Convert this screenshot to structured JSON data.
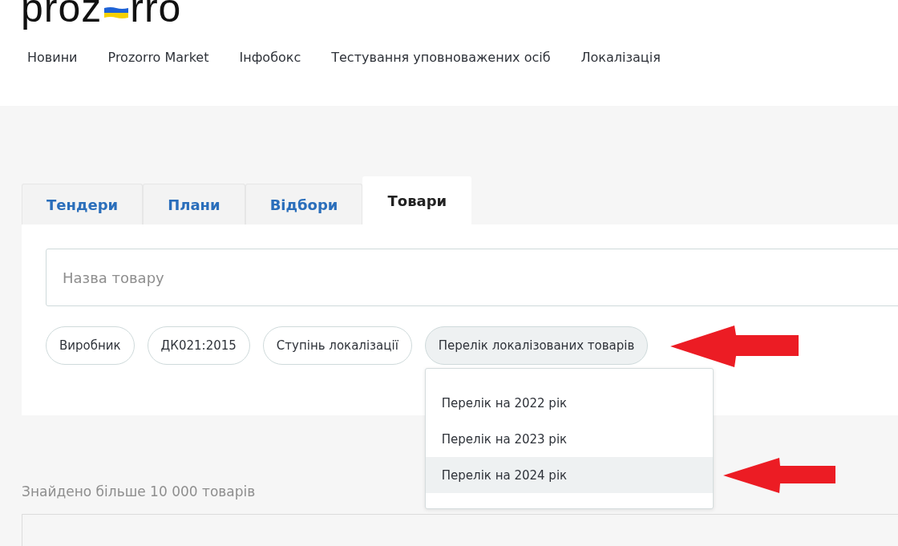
{
  "logo": {
    "before": "proz",
    "after": "rro"
  },
  "nav": [
    "Новини",
    "Prozorro Market",
    "Інфобокс",
    "Тестування уповноважених осіб",
    "Локалізація"
  ],
  "tabs": [
    {
      "label": "Тендери",
      "selected": false
    },
    {
      "label": "Плани",
      "selected": false
    },
    {
      "label": "Відбори",
      "selected": false
    },
    {
      "label": "Товари",
      "selected": true
    }
  ],
  "search": {
    "placeholder": "Назва товару"
  },
  "filters": [
    {
      "label": "Виробник",
      "selected": false
    },
    {
      "label": "ДК021:2015",
      "selected": false
    },
    {
      "label": "Ступінь локалізації",
      "selected": false
    },
    {
      "label": "Перелік локалізованих товарів",
      "selected": true
    }
  ],
  "dropdown": {
    "items": [
      {
        "label": "Перелік на 2022 рік",
        "selected": false
      },
      {
        "label": "Перелік на 2023 рік",
        "selected": false
      },
      {
        "label": "Перелік на 2024 рік",
        "selected": true
      }
    ]
  },
  "results_count": "Знайдено більше 10 000 товарів"
}
